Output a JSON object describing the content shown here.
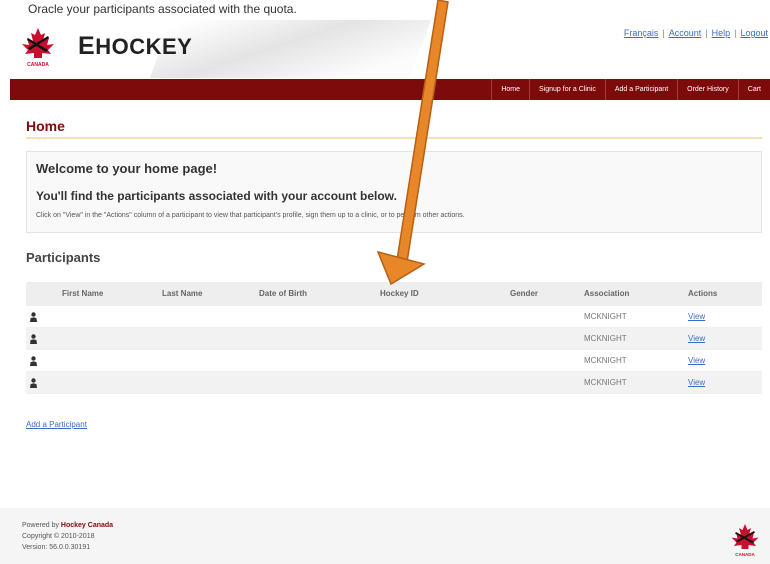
{
  "top_text": "Oracle your participants associated with the quota.",
  "header": {
    "brand_e": "E",
    "brand_rest": "HOCKEY",
    "logo_caption": "CANADA",
    "links": [
      "Français",
      "Account",
      "Help",
      "Logout"
    ]
  },
  "nav": {
    "items": [
      "Home",
      "Signup for a Clinic",
      "Add a Participant",
      "Order History",
      "Cart"
    ]
  },
  "page": {
    "title": "Home",
    "welcome_heading": "Welcome to your home page!",
    "welcome_subheading": "You'll find the participants associated with your account below.",
    "welcome_text": "Click on \"View\" in the \"Actions\" column of a participant to view that participant's profile, sign them up to a clinic, or to perform other actions."
  },
  "participants": {
    "section_title": "Participants",
    "columns": [
      "First Name",
      "Last Name",
      "Date of Birth",
      "Hockey ID",
      "Gender",
      "Association",
      "Actions"
    ],
    "rows": [
      {
        "association": "MCKNIGHT",
        "action": "View"
      },
      {
        "association": "MCKNIGHT",
        "action": "View"
      },
      {
        "association": "MCKNIGHT",
        "action": "View"
      },
      {
        "association": "MCKNIGHT",
        "action": "View"
      }
    ],
    "add_link": "Add a Participant"
  },
  "footer": {
    "powered_by": "Powered by",
    "powered_name": "Hockey Canada",
    "copyright": "Copyright © 2010-2018",
    "version": "Version: 56.0.0.30191",
    "logo_caption": "CANADA"
  },
  "colors": {
    "brand_red": "#7e0b0b",
    "link_blue": "#3b6cc7",
    "annotation_arrow": "#e8862a"
  }
}
